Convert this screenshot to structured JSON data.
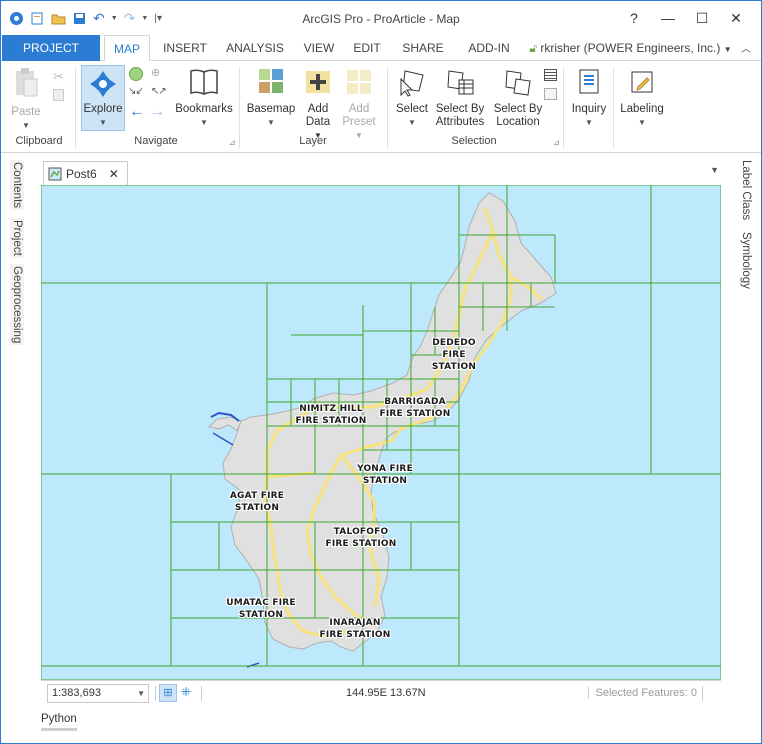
{
  "window": {
    "title": "ArcGIS Pro - ProArticle - Map",
    "controls": [
      "?",
      "—",
      "☐",
      "✕"
    ]
  },
  "tabs": [
    "PROJECT",
    "MAP",
    "INSERT",
    "ANALYSIS",
    "VIEW",
    "EDIT",
    "SHARE",
    "ADD-IN"
  ],
  "active_tab": "MAP",
  "user": "rkrisher (POWER Engineers, Inc.)",
  "ribbon": {
    "groups": [
      {
        "label": "Clipboard",
        "buttons": [
          "Paste"
        ]
      },
      {
        "label": "Navigate",
        "buttons": [
          "Explore",
          "Bookmarks"
        ]
      },
      {
        "label": "Layer",
        "buttons": [
          "Basemap",
          "Add Data",
          "Add Preset"
        ]
      },
      {
        "label": "Selection",
        "buttons": [
          "Select",
          "Select By Attributes",
          "Select By Location"
        ]
      },
      {
        "label": "",
        "buttons": [
          "Inquiry",
          "Labeling"
        ]
      }
    ],
    "add_data_top": "Add",
    "add_data_bottom": "Data",
    "add_preset_top": "Add",
    "add_preset_bottom": "Preset",
    "select_attr_top": "Select By",
    "select_attr_bottom": "Attributes",
    "select_loc_top": "Select By",
    "select_loc_bottom": "Location"
  },
  "left_dock": [
    "Contents",
    "Project",
    "Geoprocessing"
  ],
  "right_dock": [
    "Label Class",
    "Symbology"
  ],
  "map_tab": {
    "label": "Post6",
    "close": "✕"
  },
  "fire_stations": [
    {
      "line1": "DEDEDO",
      "line2": "FIRE",
      "line3": "STATION"
    },
    {
      "line1": "NIMITZ HILL",
      "line2": "FIRE STATION"
    },
    {
      "line1": "BARRIGADA",
      "line2": "FIRE STATION"
    },
    {
      "line1": "YONA FIRE",
      "line2": "STATION"
    },
    {
      "line1": "AGAT FIRE",
      "line2": "STATION"
    },
    {
      "line1": "TALOFOFO",
      "line2": "FIRE STATION"
    },
    {
      "line1": "UMATAC FIRE",
      "line2": "STATION"
    },
    {
      "line1": "INARAJAN",
      "line2": "FIRE STATION"
    }
  ],
  "status": {
    "scale": "1:383,693",
    "coordinates": "144.95E 13.67N",
    "selected": "Selected Features: 0"
  },
  "bottom_tab": "Python",
  "colors": {
    "accent": "#2b7cd3",
    "water": "#bee8fb",
    "land": "#e0e0e0",
    "grid": "#3ea832",
    "roads": "#f7e27b"
  }
}
